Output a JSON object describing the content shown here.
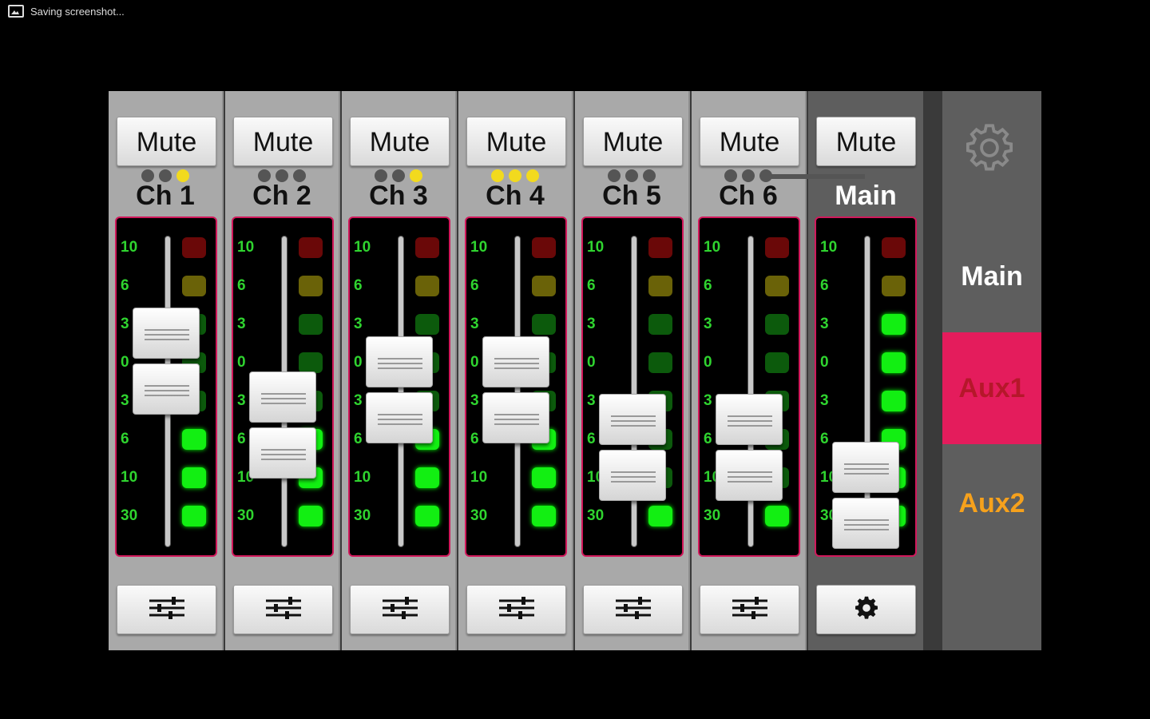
{
  "status_bar": {
    "text": "Saving screenshot..."
  },
  "channels": [
    {
      "mute_label": "Mute",
      "name": "Ch 1",
      "dots": [
        false,
        false,
        true
      ],
      "fader_level": 0.72,
      "meter_lit": 3
    },
    {
      "mute_label": "Mute",
      "name": "Ch 2",
      "dots": [
        false,
        false,
        false
      ],
      "fader_level": 0.52,
      "meter_lit": 3
    },
    {
      "mute_label": "Mute",
      "name": "Ch 3",
      "dots": [
        false,
        false,
        true
      ],
      "fader_level": 0.63,
      "meter_lit": 3
    },
    {
      "mute_label": "Mute",
      "name": "Ch 4",
      "dots": [
        true,
        true,
        true
      ],
      "fader_level": 0.63,
      "meter_lit": 3
    },
    {
      "mute_label": "Mute",
      "name": "Ch 5",
      "dots": [
        false,
        false,
        false
      ],
      "fader_level": 0.45,
      "meter_lit": 1
    },
    {
      "mute_label": "Mute",
      "name": "Ch 6",
      "dots": [
        false,
        false,
        false
      ],
      "fader_level": 0.45,
      "meter_lit": 1
    }
  ],
  "main_channel": {
    "mute_label": "Mute",
    "name": "Main",
    "fader_level": 0.3,
    "meter_lit": 6
  },
  "meter_scale": [
    "10",
    "6",
    "3",
    "0",
    "3",
    "6",
    "10",
    "30"
  ],
  "side_menu": {
    "items": [
      "Main",
      "Aux1",
      "Aux2"
    ],
    "selected": "Aux1"
  },
  "colors": {
    "accent": "#e41c5c",
    "aux2": "#f6a11c",
    "meter_green": "#12ef12",
    "link_dot_active": "#f2da1e"
  },
  "icons": {
    "top_right": "gear-icon",
    "channel_bottom": "sliders-icon",
    "main_bottom": "gear-icon"
  }
}
